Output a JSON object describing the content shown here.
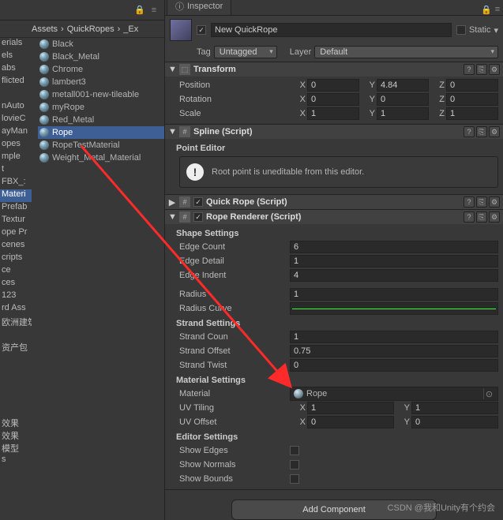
{
  "left": {
    "breadcrumb": [
      "Assets",
      "QuickRopes",
      "_Ex"
    ],
    "folders_cut": [
      "erials",
      "els",
      "abs",
      "flicted",
      "",
      "nAuto",
      "lovieC",
      "ayMan",
      "opes",
      "mple",
      "t",
      "FBX_:",
      "Materi",
      "Prefab",
      "Textur",
      "ope Pr",
      "cenes",
      "cripts",
      "ce",
      "ces",
      "123",
      "rd Ass",
      "欧洲建筑",
      "",
      "资产包",
      "",
      "",
      "",
      "",
      "",
      "效果",
      "效果",
      "模型",
      "s"
    ],
    "folders_sel_index": 12,
    "assets": [
      "Black",
      "Black_Metal",
      "Chrome",
      "lambert3",
      "metall001-new-tileable",
      "myRope",
      "Red_Metal",
      "Rope",
      "RopeTestMaterial",
      "Weight_Metal_Material"
    ],
    "asset_sel_index": 7
  },
  "inspector": {
    "tab": "Inspector",
    "name": "New QuickRope",
    "enabled_check": "✓",
    "static_label": "Static",
    "tag_label": "Tag",
    "tag_value": "Untagged",
    "layer_label": "Layer",
    "layer_value": "Default",
    "transform": {
      "title": "Transform",
      "position_label": "Position",
      "position": {
        "x": "0",
        "y": "4.84",
        "z": "0"
      },
      "rotation_label": "Rotation",
      "rotation": {
        "x": "0",
        "y": "0",
        "z": "0"
      },
      "scale_label": "Scale",
      "scale": {
        "x": "1",
        "y": "1",
        "z": "1"
      }
    },
    "spline": {
      "title": "Spline (Script)",
      "point_editor": "Point Editor",
      "info": "Root point is uneditable from this editor."
    },
    "quickrope": {
      "title": "Quick Rope (Script)"
    },
    "renderer": {
      "title": "Rope Renderer (Script)",
      "shape_header": "Shape Settings",
      "edge_count_label": "Edge Count",
      "edge_count": "6",
      "edge_detail_label": "Edge Detail",
      "edge_detail": "1",
      "edge_indent_label": "Edge Indent",
      "edge_indent": "4",
      "radius_label": "Radius",
      "radius": "1",
      "radius_curve_label": "Radius Curve",
      "strand_header": "Strand Settings",
      "strand_count_label": "Strand Coun",
      "strand_count": "1",
      "strand_offset_label": "Strand Offset",
      "strand_offset": "0.75",
      "strand_twist_label": "Strand Twist",
      "strand_twist": "0",
      "material_header": "Material Settings",
      "material_label": "Material",
      "material_value": "Rope",
      "uv_tiling_label": "UV Tiling",
      "uv_tiling": {
        "x": "1",
        "y": "1"
      },
      "uv_offset_label": "UV Offset",
      "uv_offset": {
        "x": "0",
        "y": "0"
      },
      "editor_header": "Editor Settings",
      "show_edges_label": "Show Edges",
      "show_normals_label": "Show Normals",
      "show_bounds_label": "Show Bounds"
    },
    "add_component": "Add Component"
  },
  "watermark": "CSDN @我和Unity有个约会"
}
